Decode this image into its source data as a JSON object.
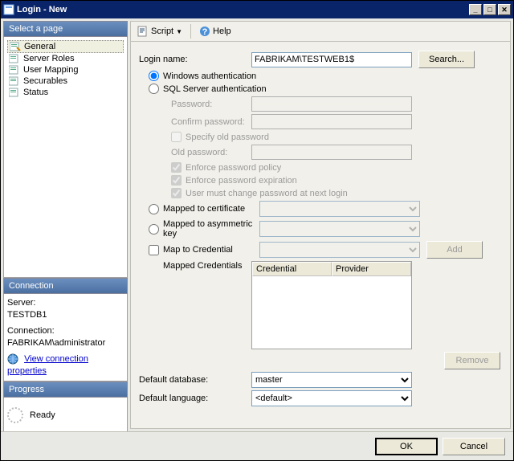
{
  "window": {
    "title": "Login - New"
  },
  "pages": {
    "heading": "Select a page",
    "items": [
      "General",
      "Server Roles",
      "User Mapping",
      "Securables",
      "Status"
    ],
    "selected": 0
  },
  "connection": {
    "heading": "Connection",
    "server_label": "Server:",
    "server_value": "TESTDB1",
    "conn_label": "Connection:",
    "conn_value": "FABRIKAM\\administrator",
    "view_link": "View connection properties"
  },
  "progress": {
    "heading": "Progress",
    "status": "Ready"
  },
  "toolbar": {
    "script": "Script",
    "help": "Help"
  },
  "form": {
    "login_name_label": "Login name:",
    "login_name_value": "FABRIKAM\\TESTWEB1$",
    "search_btn": "Search...",
    "auth_windows": "Windows authentication",
    "auth_sql": "SQL Server authentication",
    "password_label": "Password:",
    "confirm_label": "Confirm password:",
    "specify_old": "Specify old password",
    "old_password_label": "Old password:",
    "enforce_policy": "Enforce password policy",
    "enforce_expiration": "Enforce password expiration",
    "must_change": "User must change password at next login",
    "mapped_cert": "Mapped to certificate",
    "mapped_asym": "Mapped to asymmetric key",
    "map_cred": "Map to Credential",
    "add_btn": "Add",
    "mapped_creds_label": "Mapped Credentials",
    "cred_col1": "Credential",
    "cred_col2": "Provider",
    "remove_btn": "Remove",
    "default_db_label": "Default database:",
    "default_db_value": "master",
    "default_lang_label": "Default language:",
    "default_lang_value": "<default>"
  },
  "footer": {
    "ok": "OK",
    "cancel": "Cancel"
  }
}
